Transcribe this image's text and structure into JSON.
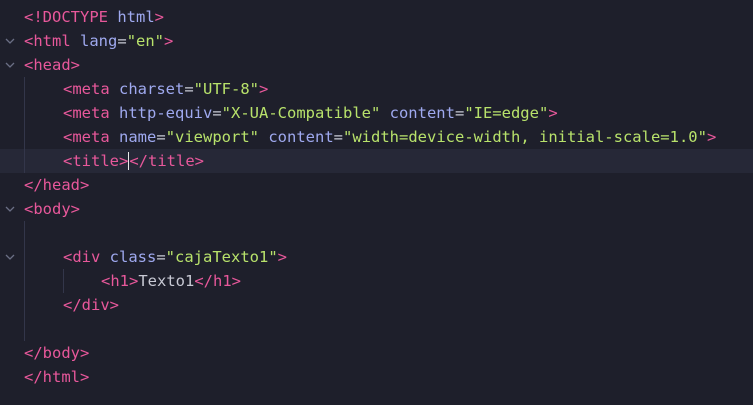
{
  "editor": {
    "language": "html",
    "cursor_line": 7,
    "lines": [
      {
        "text": "<!DOCTYPE html>"
      },
      {
        "text": "<html lang=\"en\">"
      },
      {
        "text": "<head>"
      },
      {
        "text": "<meta charset=\"UTF-8\">"
      },
      {
        "text": "<meta http-equiv=\"X-UA-Compatible\" content=\"IE=edge\">"
      },
      {
        "text": "<meta name=\"viewport\" content=\"width=device-width, initial-scale=1.0\">"
      },
      {
        "text": "<title></title>"
      },
      {
        "text": "</head>"
      },
      {
        "text": "<body>"
      },
      {
        "text": ""
      },
      {
        "text": "<div class=\"cajaTexto1\">"
      },
      {
        "text": "<h1>Texto1</h1>"
      },
      {
        "text": "</div>"
      },
      {
        "text": ""
      },
      {
        "text": "</body>"
      },
      {
        "text": "</html>"
      }
    ],
    "tokens": {
      "doctype_open": "<!DOCTYPE",
      "doctype_name": " html",
      "doctype_close": ">",
      "html_open": "<html",
      "lang_attr": " lang",
      "lang_eq": "=",
      "lang_val": "\"en\"",
      "html_open_close": ">",
      "head_open": "<head>",
      "meta1_open": "<meta",
      "charset_attr": " charset",
      "charset_eq": "=",
      "charset_val": "\"UTF-8\"",
      "meta1_close": ">",
      "meta2_open": "<meta",
      "httpequiv_attr": " http-equiv",
      "httpequiv_eq": "=",
      "httpequiv_val": "\"X-UA-Compatible\"",
      "content2_attr": " content",
      "content2_eq": "=",
      "content2_val": "\"IE=edge\"",
      "meta2_close": ">",
      "meta3_open": "<meta",
      "name_attr": " name",
      "name_eq": "=",
      "name_val": "\"viewport\"",
      "content3_attr": " content",
      "content3_eq": "=",
      "content3_val": "\"width=device-width, initial-scale=1.0\"",
      "meta3_close": ">",
      "title_open": "<title>",
      "title_close": "</title>",
      "head_close": "</head>",
      "body_open": "<body>",
      "div_open": "<div",
      "class_attr": " class",
      "class_eq": "=",
      "class_val": "\"cajaTexto1\"",
      "div_open_close": ">",
      "h1_open": "<h1>",
      "h1_text": "Texto1",
      "h1_close": "</h1>",
      "div_close": "</div>",
      "body_close": "</body>",
      "html_close": "</html>"
    },
    "fold_icons": [
      "chevron-down-icon",
      "chevron-down-icon",
      "chevron-down-icon",
      "chevron-down-icon"
    ],
    "colors": {
      "background": "#1e1f2b",
      "current_line": "#262837",
      "tag": "#e8589b",
      "attribute": "#9fa9ef",
      "string": "#b8e26b",
      "text": "#c8c9d4"
    }
  }
}
